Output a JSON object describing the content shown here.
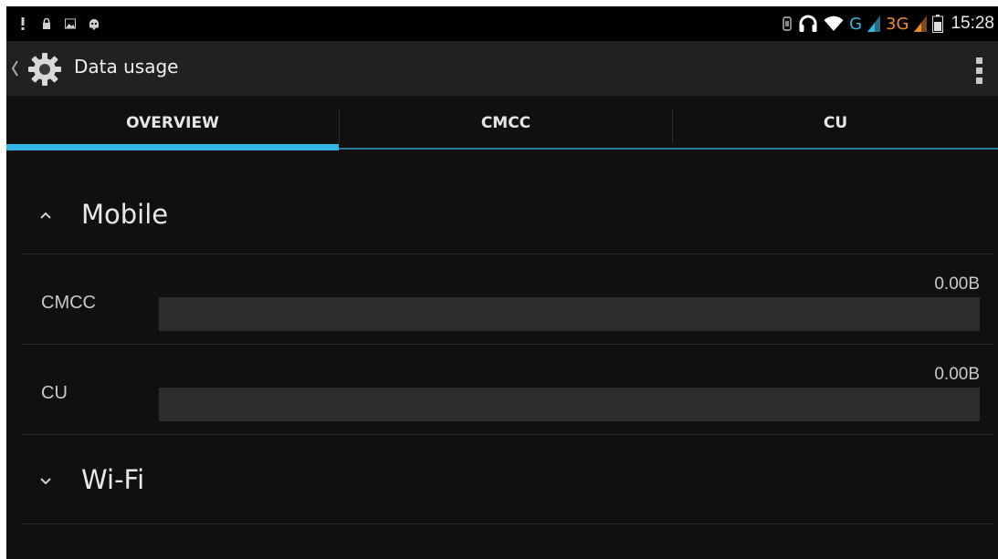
{
  "status_bar": {
    "left_icons": [
      "alert-icon",
      "lock-icon",
      "image-icon",
      "android-icon"
    ],
    "right_icons": [
      "sim-icon",
      "headphones-icon",
      "wifi-icon"
    ],
    "network_1": "G",
    "network_2": "3G",
    "time": "15:28"
  },
  "action_bar": {
    "title": "Data usage",
    "app_icon": "settings-gear-icon",
    "menu_icon": "overflow-menu-icon"
  },
  "tabs": [
    {
      "label": "OVERVIEW",
      "selected": true
    },
    {
      "label": "CMCC",
      "selected": false
    },
    {
      "label": "CU",
      "selected": false
    }
  ],
  "sections": {
    "mobile": {
      "title": "Mobile",
      "expanded": true,
      "items": [
        {
          "label": "CMCC",
          "value": "0.00B",
          "usage_fraction": 0
        },
        {
          "label": "CU",
          "value": "0.00B",
          "usage_fraction": 0
        }
      ]
    },
    "wifi": {
      "title": "Wi-Fi",
      "expanded": false
    }
  },
  "colors": {
    "accent": "#33b5e5",
    "background": "#101010",
    "action_bar": "#212121",
    "bar_track": "#2e2c2e"
  }
}
